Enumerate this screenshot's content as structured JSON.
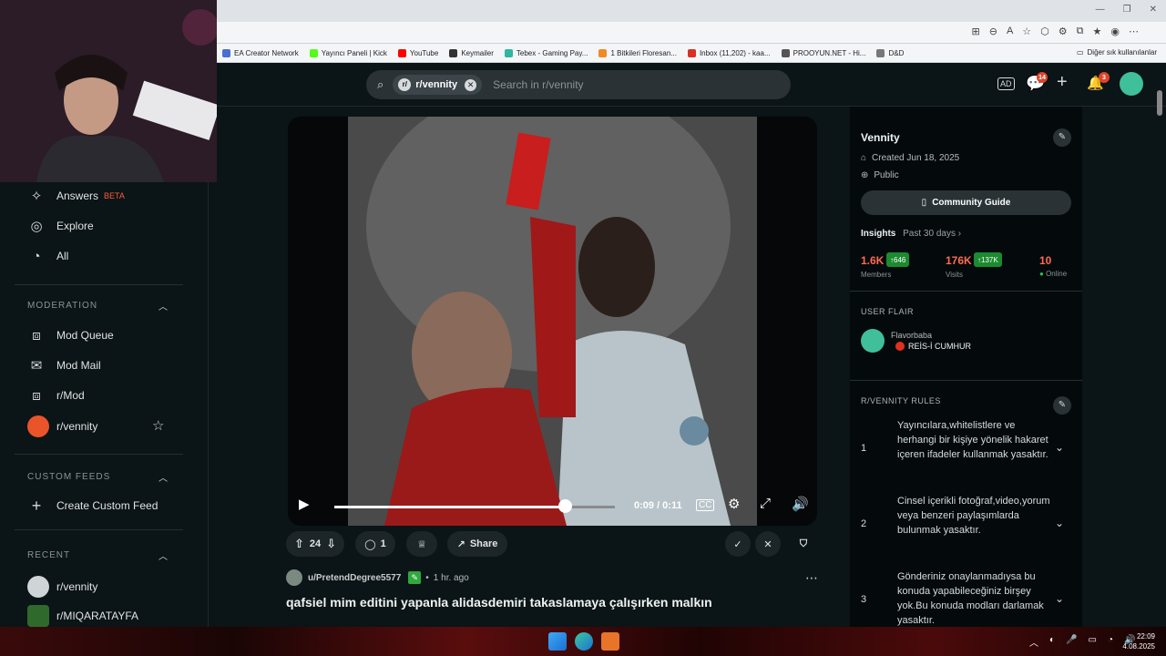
{
  "browser": {
    "bookmarks": [
      {
        "label": "EA Creator Network",
        "color": "#4a6fd1"
      },
      {
        "label": "Yayıncı Paneli | Kick",
        "color": "#53fc18"
      },
      {
        "label": "YouTube",
        "color": "#ff0000"
      },
      {
        "label": "Keymailer",
        "color": "#333333"
      },
      {
        "label": "Tebex - Gaming Pay...",
        "color": "#2fb5a0"
      },
      {
        "label": "1 Bitkileri Floresan...",
        "color": "#f08a24"
      },
      {
        "label": "Inbox (11,202) - kaa...",
        "color": "#d93025"
      },
      {
        "label": "PROOYUN.NET - Hi...",
        "color": "#555555"
      },
      {
        "label": "D&D",
        "color": "#777777"
      }
    ],
    "other_bookmarks": "Diğer sık kullanılanlar"
  },
  "header": {
    "search_chip": "r/vennity",
    "search_placeholder": "Search in r/vennity",
    "chat_badge": "14",
    "notif_badge": "3"
  },
  "left_nav": {
    "top_items": [
      {
        "label": "Answers",
        "tag": "BETA",
        "icon": "answers-icon"
      },
      {
        "label": "Explore",
        "icon": "explore-icon"
      },
      {
        "label": "All",
        "icon": "all-icon"
      }
    ],
    "moderation": {
      "heading": "MODERATION",
      "items": [
        "Mod Queue",
        "Mod Mail",
        "r/Mod",
        "r/vennity"
      ]
    },
    "custom_feeds": {
      "heading": "CUSTOM FEEDS",
      "create_label": "Create Custom Feed"
    },
    "recent": {
      "heading": "RECENT",
      "items": [
        "r/vennity",
        "r/MIQARATAYFA"
      ]
    }
  },
  "video": {
    "time": "0:09 / 0:11",
    "progress_fraction": 0.82
  },
  "post": {
    "votes": "24",
    "comments": "1",
    "share_label": "Share",
    "author": "u/PretendDegree5577",
    "age": "1 hr. ago",
    "title": "qafsiel mim editini yapanla alidasdemiri takaslamaya çalışırken malkın"
  },
  "community": {
    "name": "Vennity",
    "created": "Created Jun 18, 2025",
    "visibility": "Public",
    "guide_label": "Community Guide",
    "insights_label": "Insights",
    "insights_range": "Past 30 days",
    "stats": [
      {
        "value": "1.6K",
        "delta": "646",
        "label": "Members"
      },
      {
        "value": "176K",
        "delta": "137K",
        "label": "Visits"
      },
      {
        "value": "10",
        "label": "Online"
      }
    ],
    "flair_heading": "USER FLAIR",
    "flair_user": "Flavorbaba",
    "flair_text": "REİS-İ CUMHUR",
    "rules_heading": "R/VENNITY RULES",
    "rules": [
      {
        "num": "1",
        "text": "Yayıncılara,whitelistlere ve herhangi bir kişiye yönelik hakaret içeren ifadeler kullanmak yasaktır."
      },
      {
        "num": "2",
        "text": "Cinsel içerikli fotoğraf,video,yorum veya benzeri paylaşımlarda bulunmak yasaktır."
      },
      {
        "num": "3",
        "text": "Gönderiniz onaylanmadıysa bu konuda yapabileceğiniz birşey yok.Bu konuda modları darlamak yasaktır."
      }
    ]
  },
  "taskbar": {
    "time": "22:09",
    "date": "4.08.2025"
  }
}
